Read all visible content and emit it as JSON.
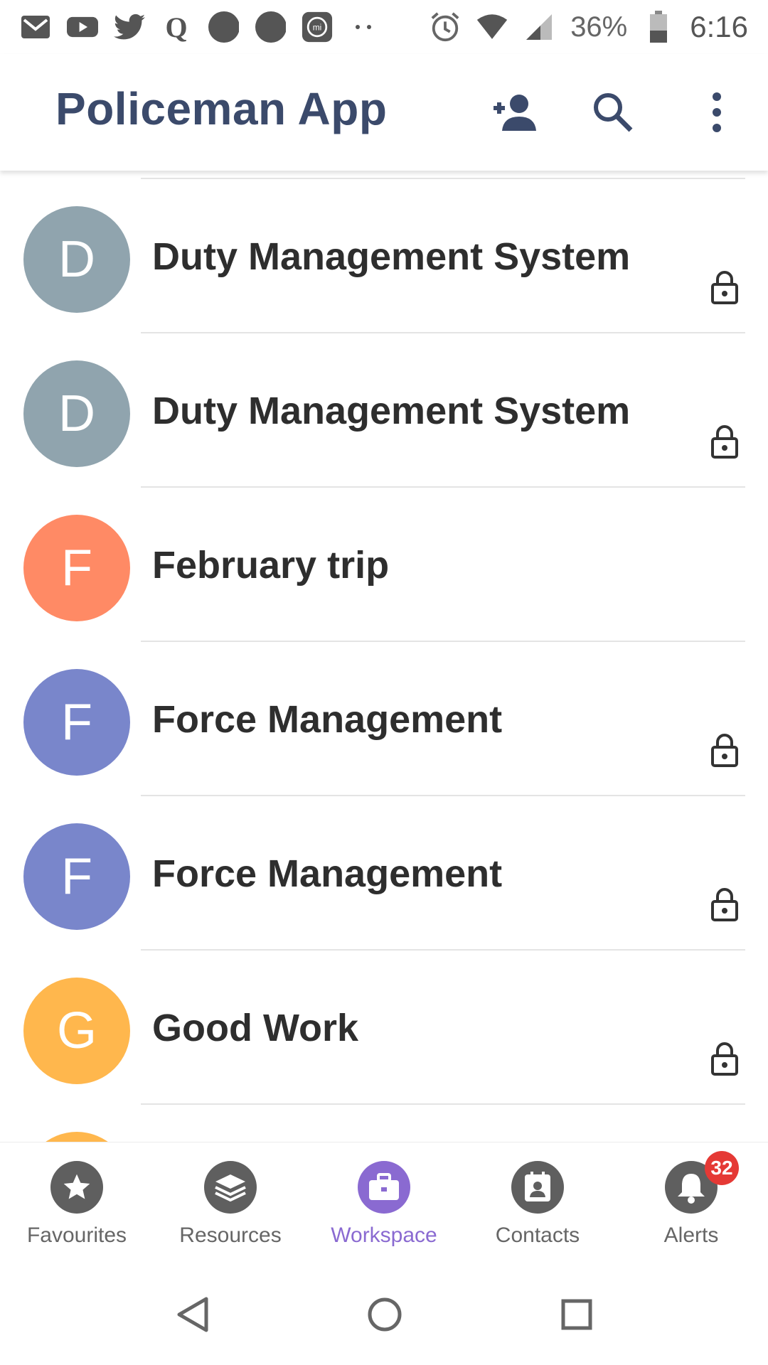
{
  "status_bar": {
    "battery_text": "36%",
    "time": "6:16",
    "left_icons": [
      "gmail-icon",
      "youtube-icon",
      "twitter-icon",
      "quora-icon",
      "dot-icon",
      "dot-icon",
      "mi-icon",
      "more-dots-icon"
    ],
    "right_icons": [
      "alarm-icon",
      "wifi-icon",
      "signal-icon",
      "battery-icon"
    ]
  },
  "app_bar": {
    "title": "Policeman App",
    "actions": [
      "add-person-icon",
      "search-icon",
      "more-vert-icon"
    ]
  },
  "workspaces": [
    {
      "initial": "D",
      "name": "Duty Management System",
      "color": "#90a4ae",
      "locked": true
    },
    {
      "initial": "D",
      "name": "Duty Management System",
      "color": "#90a4ae",
      "locked": true
    },
    {
      "initial": "F",
      "name": "February trip",
      "color": "#ff8a65",
      "locked": false
    },
    {
      "initial": "F",
      "name": "Force Management",
      "color": "#7986cb",
      "locked": true
    },
    {
      "initial": "F",
      "name": "Force Management",
      "color": "#7986cb",
      "locked": true
    },
    {
      "initial": "G",
      "name": "Good Work",
      "color": "#ffb74d",
      "locked": true
    }
  ],
  "bottom_nav": {
    "items": [
      {
        "label": "Favourites",
        "icon": "star-icon",
        "active": false
      },
      {
        "label": "Resources",
        "icon": "layers-icon",
        "active": false
      },
      {
        "label": "Workspace",
        "icon": "briefcase-icon",
        "active": true
      },
      {
        "label": "Contacts",
        "icon": "contact-card-icon",
        "active": false
      },
      {
        "label": "Alerts",
        "icon": "bell-icon",
        "active": false,
        "badge": "32"
      }
    ],
    "active_color": "#8a6ad1"
  },
  "system_nav": [
    "back-icon",
    "home-icon",
    "recents-icon"
  ]
}
